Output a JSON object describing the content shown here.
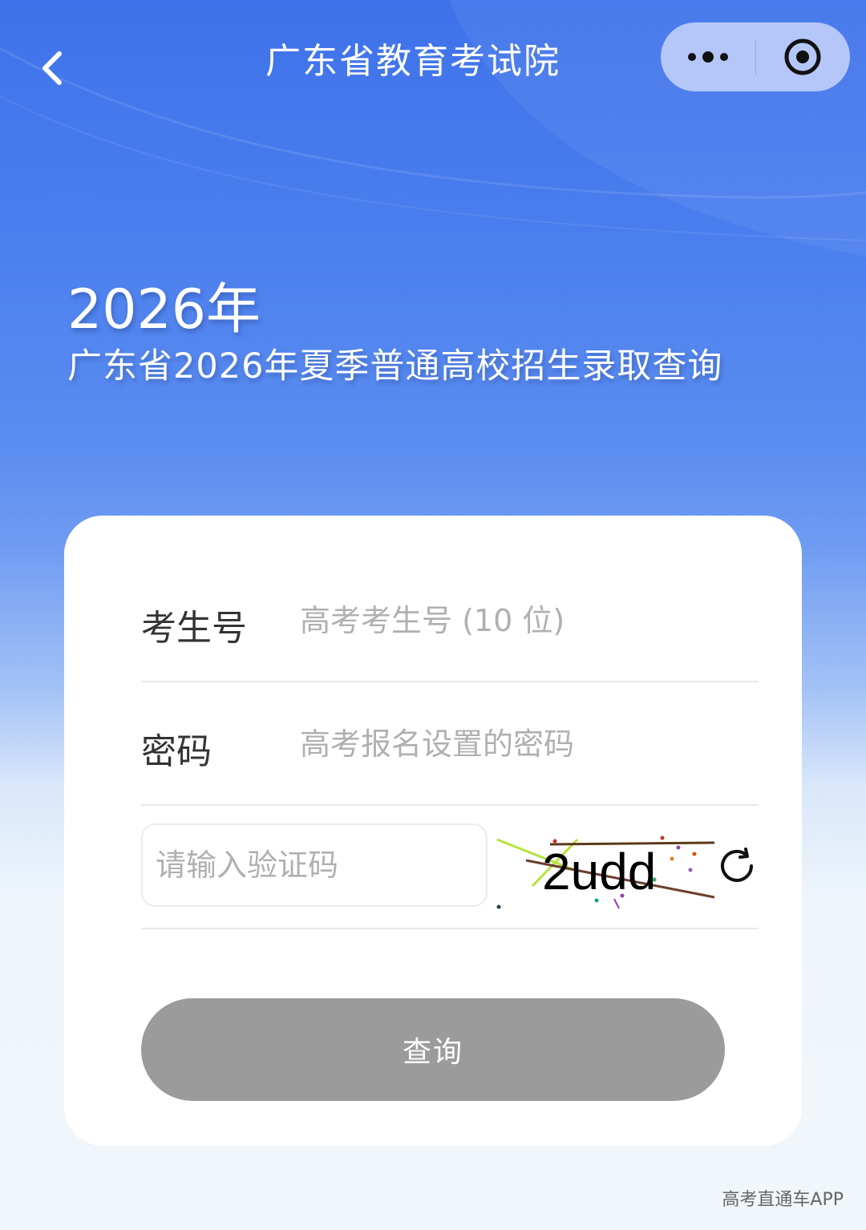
{
  "header": {
    "title": "广东省教育考试院",
    "back_icon": "chevron-left-icon",
    "more_icon": "more-dots-icon",
    "close_icon": "target-close-icon"
  },
  "hero": {
    "year": "2026年",
    "subtitle": "广东省2026年夏季普通高校招生录取查询"
  },
  "form": {
    "candidate_label": "考生号",
    "candidate_placeholder": "高考考生号 (10 位)",
    "password_label": "密码",
    "password_placeholder": "高考报名设置的密码",
    "captcha_placeholder": "请输入验证码",
    "captcha_text": "2udd",
    "refresh_icon": "refresh-icon",
    "submit_label": "查询"
  },
  "watermark": "高考直通车APP",
  "colors": {
    "primary_blue": "#3f72ea",
    "button_gray": "#9b9b9b",
    "card_bg": "#ffffff"
  }
}
